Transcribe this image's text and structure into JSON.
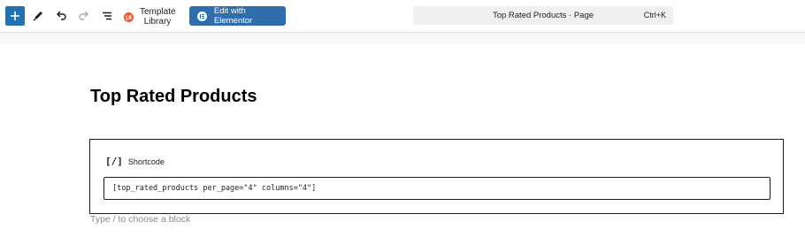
{
  "toolbar": {
    "add_block_label": "Add block",
    "tools_label": "Tools",
    "undo_label": "Undo",
    "redo_label": "Redo",
    "document_overview_label": "Document Overview",
    "template_library": {
      "line1": "Template",
      "line2": "Library"
    },
    "elementor_button": "Edit with Elementor",
    "command_bar": {
      "title": "Top Rated Products · Page",
      "shortcut": "Ctrl+K"
    }
  },
  "editor": {
    "page_title": "Top Rated Products",
    "shortcode_block": {
      "icon_glyph": "[/]",
      "label": "Shortcode",
      "value": "[top_rated_products per_page=\"4\" columns=\"4\"]"
    },
    "block_prompt": "Type / to choose a block"
  },
  "colors": {
    "wp_blue": "#2271b1",
    "elementor_blue": "#2f6dac",
    "template_library_orange": "#f0542b",
    "command_bar_bg": "#f0f0f0",
    "text_dark": "#1e1e1e",
    "placeholder_gray": "#8a8a8a"
  }
}
